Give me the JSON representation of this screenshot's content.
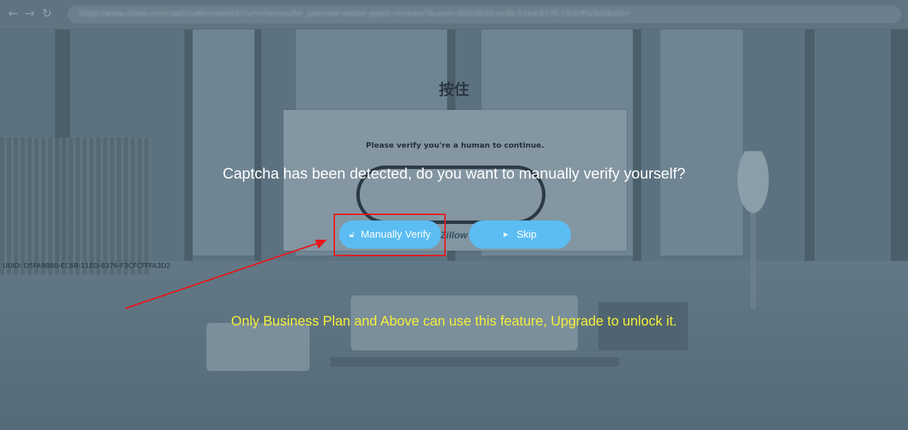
{
  "browser": {
    "url": "https://www.zillow.com/captchaPerimeterX/?url=/homes/for_sale/real-estate-agent-reviews/?&uuid=d5fa9b60-ec6b-11ed-8376-f3cfcfffa3d2&vid="
  },
  "captcha_page": {
    "prompt": "Please verify you're a human to continue.",
    "press_hold_label": "按住",
    "logo_text": "Zillow",
    "uuid": "UUID: D5FA9B60-EC6B-11ED-8376-F3CFCFFFA3D2"
  },
  "dialog": {
    "title": "Captcha has been detected, do you want to manually verify yourself?",
    "verify_label": "Manually Verify",
    "skip_label": "Skip",
    "note": "Only Business Plan and Above can use this feature, Upgrade to unlock it."
  },
  "colors": {
    "button": "#5bbdf2",
    "highlight": "#e8161b",
    "note": "#f3ee3c"
  },
  "icons": {
    "back": "arrow-left-icon",
    "forward": "arrow-right-icon",
    "reload": "reload-icon",
    "lock": "lock-icon",
    "play": "play-icon"
  }
}
